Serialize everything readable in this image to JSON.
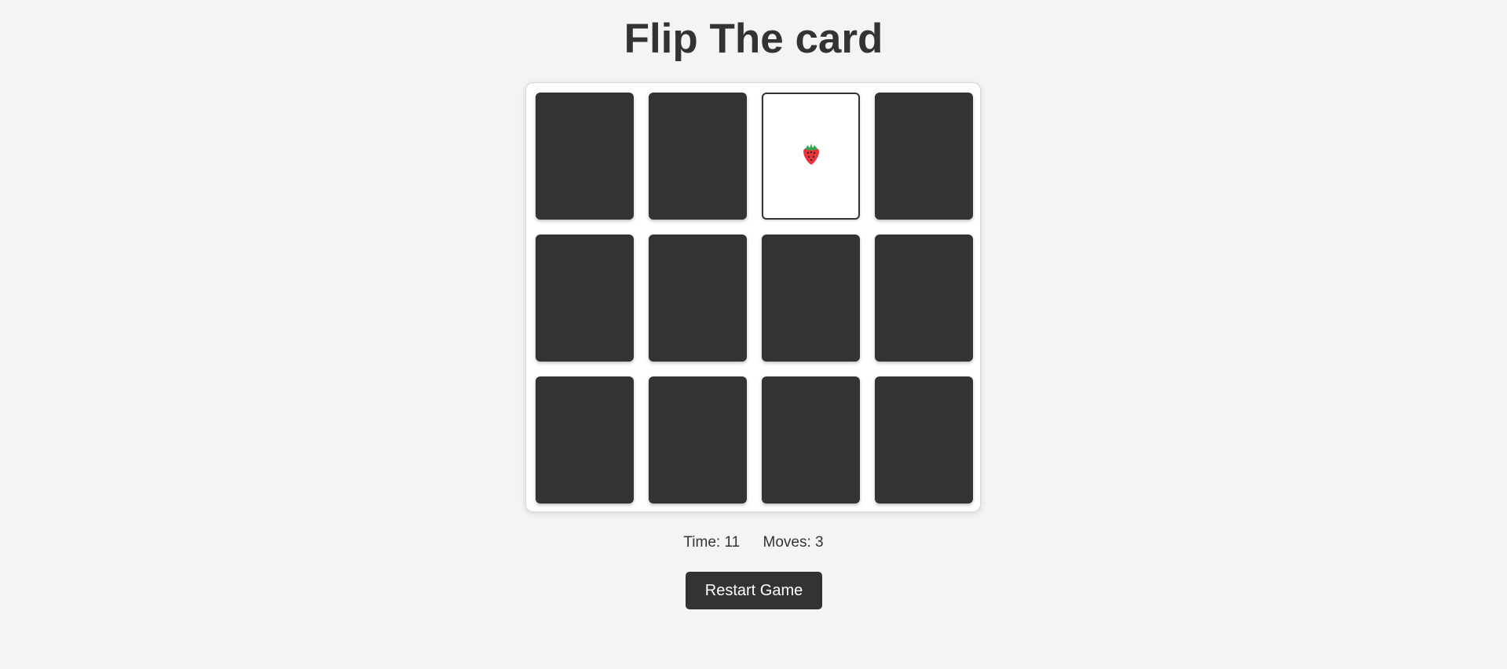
{
  "header": {
    "title": "Flip The card"
  },
  "board": {
    "columns": 4,
    "rows": 3,
    "cards": [
      {
        "state": "face-down",
        "symbol": ""
      },
      {
        "state": "face-down",
        "symbol": ""
      },
      {
        "state": "face-up",
        "symbol": "strawberry-icon"
      },
      {
        "state": "face-down",
        "symbol": ""
      },
      {
        "state": "face-down",
        "symbol": ""
      },
      {
        "state": "face-down",
        "symbol": ""
      },
      {
        "state": "face-down",
        "symbol": ""
      },
      {
        "state": "face-down",
        "symbol": ""
      },
      {
        "state": "face-down",
        "symbol": ""
      },
      {
        "state": "face-down",
        "symbol": ""
      },
      {
        "state": "face-down",
        "symbol": ""
      },
      {
        "state": "face-down",
        "symbol": ""
      }
    ]
  },
  "stats": {
    "time_label": "Time: 11",
    "moves_label": "Moves: 3"
  },
  "controls": {
    "restart_label": "Restart Game"
  },
  "colors": {
    "background": "#f4f4f4",
    "card_back": "#333333",
    "card_front": "#ffffff",
    "button": "#333333",
    "text": "#333333"
  }
}
